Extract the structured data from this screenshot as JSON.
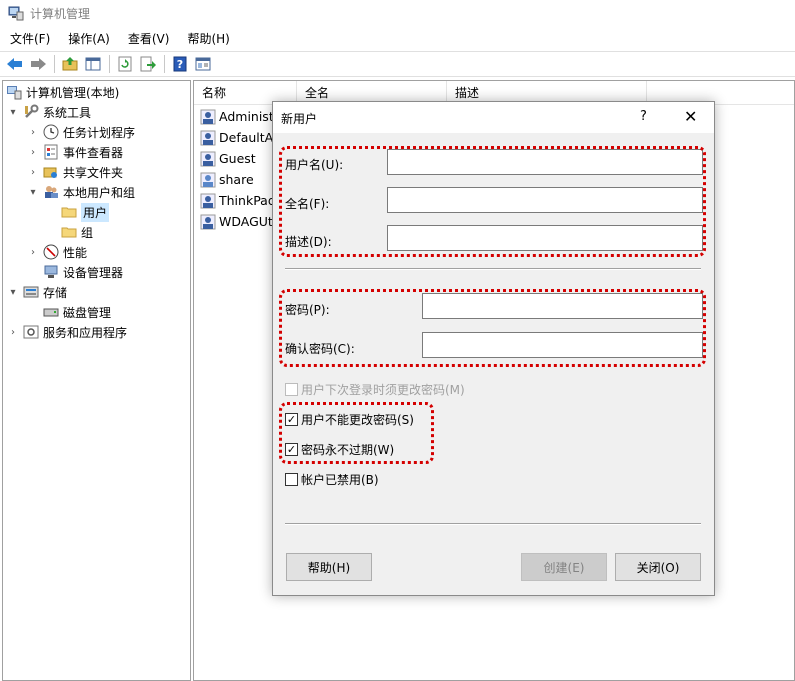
{
  "window": {
    "title": "计算机管理"
  },
  "menu": [
    "文件(F)",
    "操作(A)",
    "查看(V)",
    "帮助(H)"
  ],
  "toolbar": [
    "back-icon",
    "forward-icon",
    "up-folder-icon",
    "show-hide-tree-icon",
    "refresh-icon",
    "export-icon",
    "help-icon",
    "properties-icon"
  ],
  "tree": {
    "root": "计算机管理(本地)",
    "system_tools": "系统工具",
    "task_scheduler": "任务计划程序",
    "event_viewer": "事件查看器",
    "shared_folders": "共享文件夹",
    "local_users_groups": "本地用户和组",
    "users": "用户",
    "groups": "组",
    "performance": "性能",
    "device_manager": "设备管理器",
    "storage": "存储",
    "disk_management": "磁盘管理",
    "services_apps": "服务和应用程序"
  },
  "list": {
    "columns": [
      "名称",
      "全名",
      "描述"
    ],
    "rows": [
      "Administr",
      "DefaultAc",
      "Guest",
      "share",
      "ThinkPad",
      "WDAGUti"
    ]
  },
  "dialog": {
    "title": "新用户",
    "help": "?",
    "close": "✕",
    "username_label": "用户名(U):",
    "fullname_label": "全名(F):",
    "description_label": "描述(D):",
    "password_label": "密码(P):",
    "confirm_label": "确认密码(C):",
    "username_value": "",
    "fullname_value": "",
    "description_value": "",
    "password_value": "",
    "confirm_value": "",
    "must_change_label": "用户下次登录时须更改密码(M)",
    "must_change_checked": false,
    "cannot_change_label": "用户不能更改密码(S)",
    "cannot_change_checked": true,
    "never_expires_label": "密码永不过期(W)",
    "never_expires_checked": true,
    "disabled_label": "帐户已禁用(B)",
    "disabled_checked": false,
    "help_button": "帮助(H)",
    "create_button": "创建(E)",
    "close_button": "关闭(O)"
  },
  "colors": {
    "highlight": "#d40000",
    "selection": "#cce8ff",
    "dialog_bg": "#f0f0f0"
  }
}
